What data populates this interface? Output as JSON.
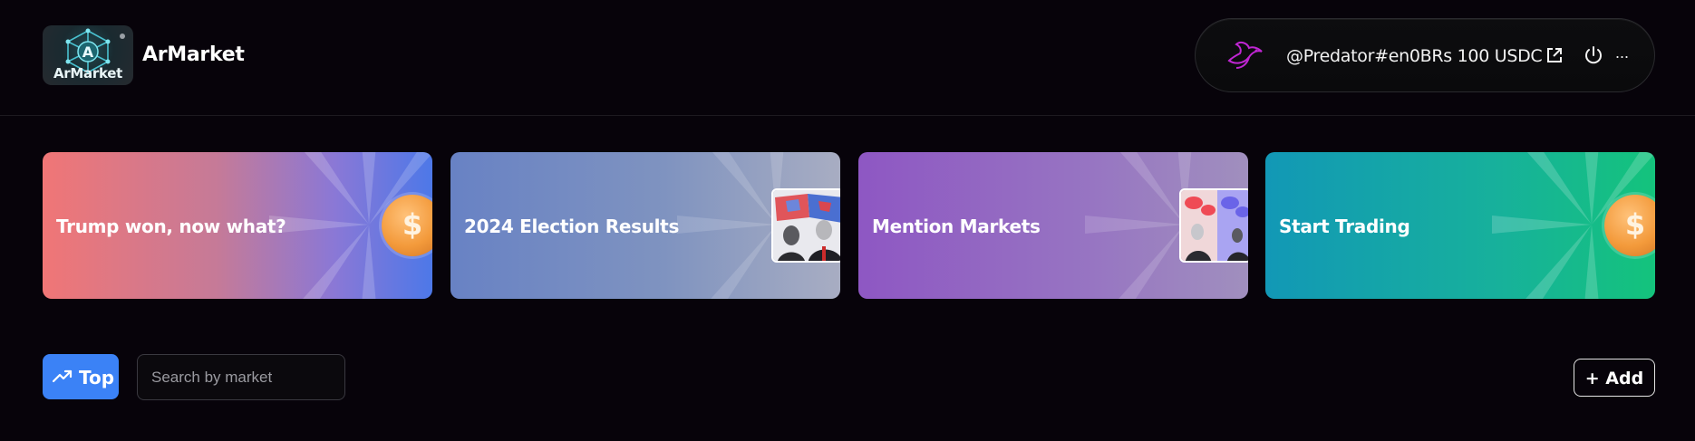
{
  "header": {
    "logo_text": "ArMarket",
    "brand": "ArMarket",
    "account": {
      "handle": "@Predator#en0BRs 100 USDC",
      "more": "..."
    }
  },
  "banners": [
    {
      "label": "Trump won, now what?",
      "art": "coin-icon"
    },
    {
      "label": "2024 Election Results",
      "art": "election-photo"
    },
    {
      "label": "Mention Markets",
      "art": "mention-photo"
    },
    {
      "label": "Start Trading",
      "art": "coin-icon"
    }
  ],
  "controls": {
    "top_label": "Top",
    "search_placeholder": "Search by market",
    "search_value": "",
    "add_label": "+ Add"
  },
  "colors": {
    "background": "#07030a",
    "accent": "#3b82f6"
  }
}
